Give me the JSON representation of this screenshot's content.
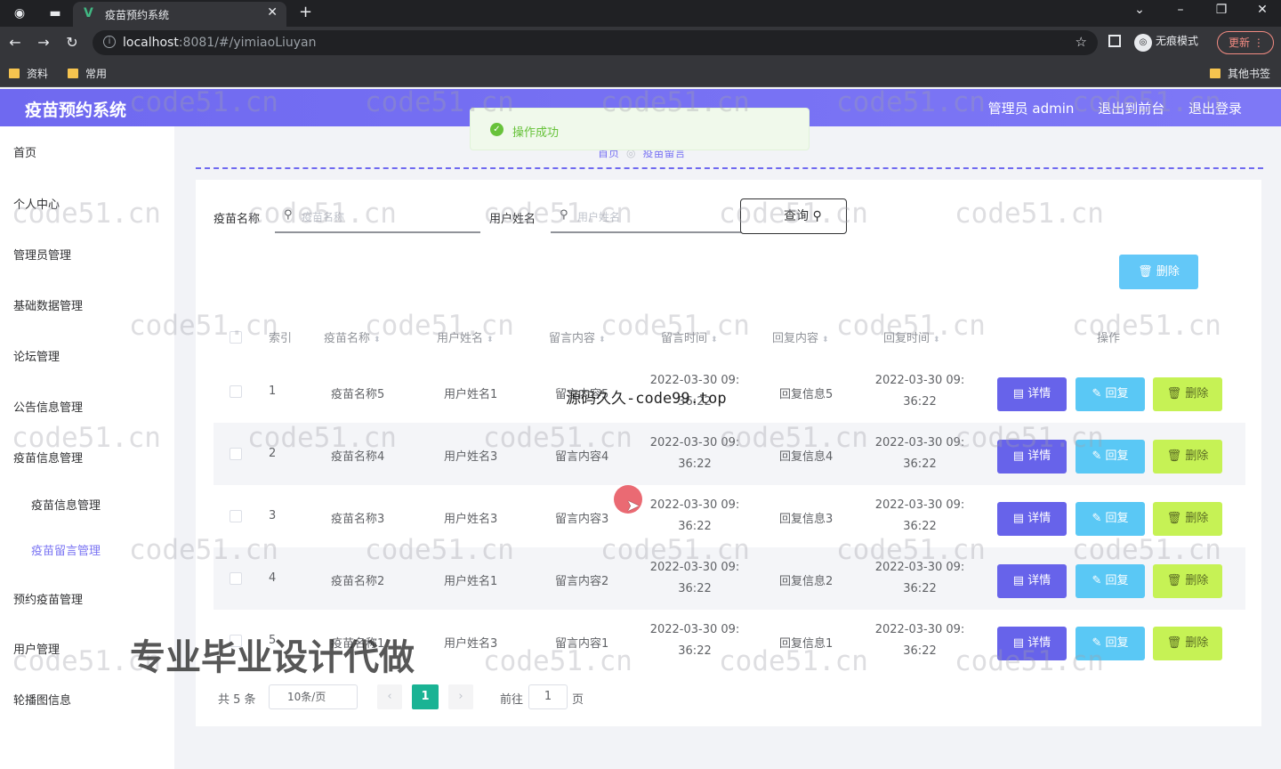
{
  "browser": {
    "tab_title": "疫苗预约系统",
    "url_host": "localhost",
    "url_rest": ":8081/#/yimiaoLiuyan",
    "incognito_label": "无痕模式",
    "update_label": "更新",
    "bookmarks": [
      "资料",
      "常用"
    ],
    "other_bookmarks": "其他书签"
  },
  "header": {
    "title": "疫苗预约系统",
    "user": "管理员 admin",
    "back_front": "退出到前台",
    "logout": "退出登录"
  },
  "sidebar": {
    "items": [
      "首页",
      "个人中心",
      "管理员管理",
      "基础数据管理",
      "论坛管理",
      "公告信息管理",
      "疫苗信息管理",
      "疫苗信息管理",
      "疫苗留言管理",
      "预约疫苗管理",
      "用户管理",
      "轮播图信息"
    ]
  },
  "breadcrumb": {
    "home": "首页",
    "current": "疫苗留言"
  },
  "toast": {
    "message": "操作成功"
  },
  "search": {
    "vaccine_label": "疫苗名称",
    "vaccine_placeholder": "疫苗名称",
    "user_label": "用户姓名",
    "user_placeholder": "用户姓名",
    "query_button": "查询"
  },
  "toolbar": {
    "delete_label": "删除"
  },
  "table": {
    "headers": [
      "索引",
      "疫苗名称",
      "用户姓名",
      "留言内容",
      "留言时间",
      "回复内容",
      "回复时间",
      "操作"
    ],
    "rows": [
      {
        "index": "1",
        "vaccine": "疫苗名称5",
        "user": "用户姓名1",
        "content": "留言内容5",
        "time_date": "2022-03-30 09:",
        "time_clock": "36:22",
        "reply": "回复信息5",
        "reply_date": "2022-03-30 09:",
        "reply_clock": "36:22"
      },
      {
        "index": "2",
        "vaccine": "疫苗名称4",
        "user": "用户姓名3",
        "content": "留言内容4",
        "time_date": "2022-03-30 09:",
        "time_clock": "36:22",
        "reply": "回复信息4",
        "reply_date": "2022-03-30 09:",
        "reply_clock": "36:22"
      },
      {
        "index": "3",
        "vaccine": "疫苗名称3",
        "user": "用户姓名3",
        "content": "留言内容3",
        "time_date": "2022-03-30 09:",
        "time_clock": "36:22",
        "reply": "回复信息3",
        "reply_date": "2022-03-30 09:",
        "reply_clock": "36:22"
      },
      {
        "index": "4",
        "vaccine": "疫苗名称2",
        "user": "用户姓名1",
        "content": "留言内容2",
        "time_date": "2022-03-30 09:",
        "time_clock": "36:22",
        "reply": "回复信息2",
        "reply_date": "2022-03-30 09:",
        "reply_clock": "36:22"
      },
      {
        "index": "5",
        "vaccine": "疫苗名称1",
        "user": "用户姓名3",
        "content": "留言内容1",
        "time_date": "2022-03-30 09:",
        "time_clock": "36:22",
        "reply": "回复信息1",
        "reply_date": "2022-03-30 09:",
        "reply_clock": "36:22"
      }
    ],
    "action_detail": "详情",
    "action_reply": "回复",
    "action_delete": "删除"
  },
  "pagination": {
    "total": "共 5 条",
    "page_size": "10条/页",
    "current_page": "1",
    "goto_prefix": "前往",
    "goto_value": "1",
    "goto_suffix": "页"
  },
  "overlays": {
    "watermark": "code51.cn",
    "middle_text": "源码久久-code99.top",
    "bottom_text": "专业毕业设计代做"
  },
  "colors": {
    "header": "#6f69f0",
    "detail_button": "#6763ea",
    "reply_button": "#5ac8f5",
    "delete_button": "#c6f255",
    "pager_active": "#1ab394"
  }
}
